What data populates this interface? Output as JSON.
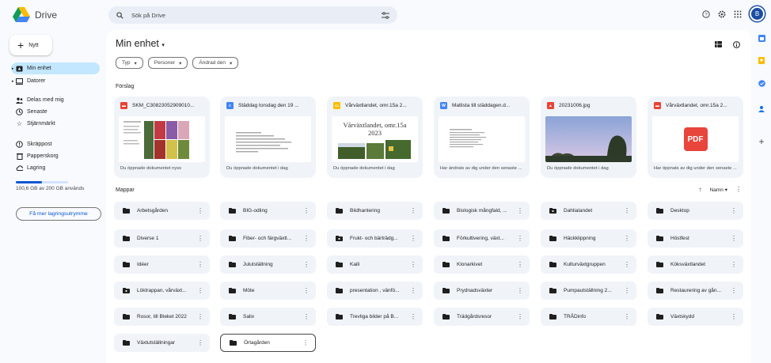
{
  "app": {
    "name": "Drive"
  },
  "search": {
    "placeholder": "Sök på Drive"
  },
  "user": {
    "initial": "B"
  },
  "sidebar": {
    "new_label": "Nytt",
    "items": [
      {
        "label": "Min enhet",
        "icon": "my-drive-icon",
        "active": true
      },
      {
        "label": "Datorer",
        "icon": "computer-icon"
      },
      {
        "label": "Delas med mig",
        "icon": "shared-icon"
      },
      {
        "label": "Senaste",
        "icon": "clock-icon"
      },
      {
        "label": "Stjärnmärkt",
        "icon": "star-icon"
      },
      {
        "label": "Skräppost",
        "icon": "spam-icon"
      },
      {
        "label": "Papperskorg",
        "icon": "trash-icon"
      },
      {
        "label": "Lagring",
        "icon": "cloud-icon"
      }
    ],
    "storage_fraction": 0.503,
    "storage_text": "100,6 GB av 200 GB används",
    "more_storage": "Få mer lagringsutrymme"
  },
  "main": {
    "title": "Min enhet",
    "filters": [
      "Typ",
      "Personer",
      "Ändrad den"
    ],
    "suggested_label": "Förslag",
    "folders_label": "Mappar",
    "sort_label": "Namn"
  },
  "suggestions": [
    {
      "name": "SKM_C30823052909010...",
      "type": "pdf",
      "footer": "Du öppnade dokumentet nyss"
    },
    {
      "name": "Städdag torsdag den 19 ...",
      "type": "doc",
      "footer": "Du öppnade dokumentet i dag"
    },
    {
      "name": "Vårväxtlandet, omr.15a 2...",
      "type": "slides",
      "footer": "Du öppnade dokumentet i dag",
      "preview_title": "Vårväxtlandet, omr.15a",
      "preview_year": "2023"
    },
    {
      "name": "Matlista till städdagen.d...",
      "type": "doc",
      "footer": "Har ändrats av dig under den senaste ..."
    },
    {
      "name": "20231006.jpg",
      "type": "image",
      "footer": "Du öppnade dokumentet i dag"
    },
    {
      "name": "Vårväxtlandet, omr.15a 2...",
      "type": "pdf",
      "footer": "Har öppnats av dig under den senaste ...",
      "preview_badge": "PDF"
    }
  ],
  "folders": [
    {
      "name": "Arbetsgården"
    },
    {
      "name": "BIG-odling"
    },
    {
      "name": "Bildhantering"
    },
    {
      "name": "Biologisk mångfald, ..."
    },
    {
      "name": "Dahlialandet",
      "shared": true
    },
    {
      "name": "Desktop"
    },
    {
      "name": "Diverse 1"
    },
    {
      "name": "Fiber- och färgväxtl..."
    },
    {
      "name": "Frukt- och bärträdg...",
      "shared": true
    },
    {
      "name": "Förkultivering, växt..."
    },
    {
      "name": "Häckklippning"
    },
    {
      "name": "Höstfest"
    },
    {
      "name": "Idéer"
    },
    {
      "name": "Julutställning"
    },
    {
      "name": "Kaili"
    },
    {
      "name": "Klonarkivet"
    },
    {
      "name": "Kulturväxtgruppen"
    },
    {
      "name": "Köksväxtlandet"
    },
    {
      "name": "Löktrappan, vårväxt...",
      "shared": true
    },
    {
      "name": "Möte"
    },
    {
      "name": "presentation , vänfö..."
    },
    {
      "name": "Prydnadsväxter"
    },
    {
      "name": "Pumpautställning 2..."
    },
    {
      "name": "Restaurering av gån..."
    },
    {
      "name": "Rosor, till Bleket 2022"
    },
    {
      "name": "Salix"
    },
    {
      "name": "Trevliga bilder på B..."
    },
    {
      "name": "Trädgårdsresor"
    },
    {
      "name": "TRÅDinfo"
    },
    {
      "name": "Växtskydd"
    },
    {
      "name": "Växtutställningar"
    },
    {
      "name": "Örtagården",
      "selected": true
    }
  ],
  "colors": {
    "accent": "#0b57d0",
    "active_bg": "#c2e7ff",
    "pdf": "#ea4335",
    "doc": "#4285f4",
    "slides": "#fbbc04"
  }
}
